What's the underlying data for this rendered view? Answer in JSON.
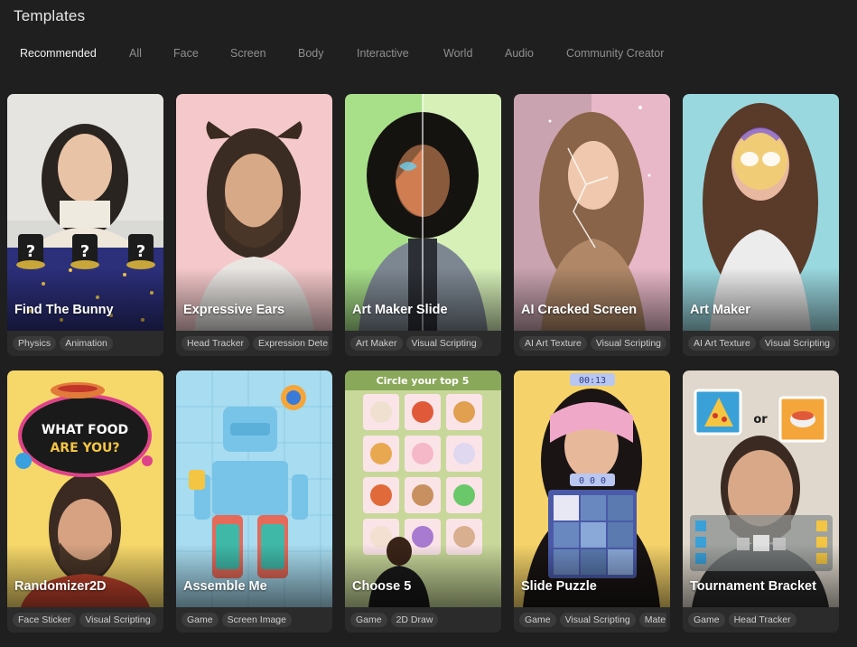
{
  "page": {
    "title": "Templates"
  },
  "tabs": [
    {
      "label": "Recommended",
      "active": true
    },
    {
      "label": "All"
    },
    {
      "label": "Face"
    },
    {
      "label": "Screen"
    },
    {
      "label": "Body"
    },
    {
      "label": "Interactive"
    },
    {
      "label": "World"
    },
    {
      "label": "Audio"
    },
    {
      "label": "Community Creator"
    }
  ],
  "cards": [
    {
      "title": "Find The Bunny",
      "tags": [
        "Physics",
        "Animation"
      ]
    },
    {
      "title": "Expressive Ears",
      "tags": [
        "Head Tracker",
        "Expression Dete"
      ]
    },
    {
      "title": "Art Maker Slide",
      "tags": [
        "Art Maker",
        "Visual Scripting"
      ]
    },
    {
      "title": "AI Cracked Screen",
      "tags": [
        "AI Art Texture",
        "Visual Scripting"
      ]
    },
    {
      "title": "Art Maker",
      "tags": [
        "AI Art Texture",
        "Visual Scripting"
      ]
    },
    {
      "title": "Randomizer2D",
      "tags": [
        "Face Sticker",
        "Visual Scripting"
      ]
    },
    {
      "title": "Assemble Me",
      "tags": [
        "Game",
        "Screen Image"
      ]
    },
    {
      "title": "Choose 5",
      "tags": [
        "Game",
        "2D Draw"
      ]
    },
    {
      "title": "Slide Puzzle",
      "tags": [
        "Game",
        "Visual Scripting",
        "Mate"
      ]
    },
    {
      "title": "Tournament Bracket",
      "tags": [
        "Game",
        "Head Tracker"
      ]
    }
  ],
  "overlays": {
    "food_line1": "WHAT FOOD",
    "food_line2": "ARE YOU?",
    "circle_top": "Circle your top 5",
    "timer": "00:13",
    "puzzle_counter": "0 0 0",
    "versus": "or"
  },
  "colors": {
    "background": "#1f1f1f",
    "card": "#2b2b2b",
    "tag": "#3b3b3b",
    "tab_active": "#f0f0f0",
    "tab_inactive": "#8f8f8f"
  }
}
